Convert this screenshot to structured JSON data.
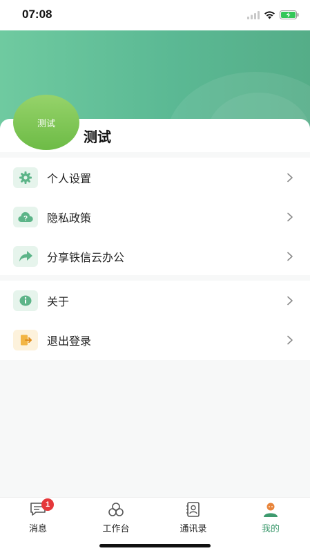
{
  "status_bar": {
    "time": "07:08"
  },
  "profile": {
    "avatar_text": "测试",
    "name": "测试"
  },
  "menu": {
    "group1": [
      {
        "label": "个人设置",
        "icon": "gear-icon"
      },
      {
        "label": "隐私政策",
        "icon": "question-cloud-icon"
      },
      {
        "label": "分享铁信云办公",
        "icon": "share-arrow-icon"
      }
    ],
    "group2": [
      {
        "label": "关于",
        "icon": "info-icon"
      },
      {
        "label": "退出登录",
        "icon": "logout-icon"
      }
    ]
  },
  "tabbar": {
    "tabs": [
      {
        "label": "消息",
        "icon": "message-icon",
        "badge": "1"
      },
      {
        "label": "工作台",
        "icon": "workbench-icon"
      },
      {
        "label": "通讯录",
        "icon": "contacts-icon"
      },
      {
        "label": "我的",
        "icon": "profile-icon",
        "active": true
      }
    ]
  },
  "colors": {
    "accent": "#3e9a6e",
    "hero": "#5bb994",
    "badge": "#e5383b"
  }
}
